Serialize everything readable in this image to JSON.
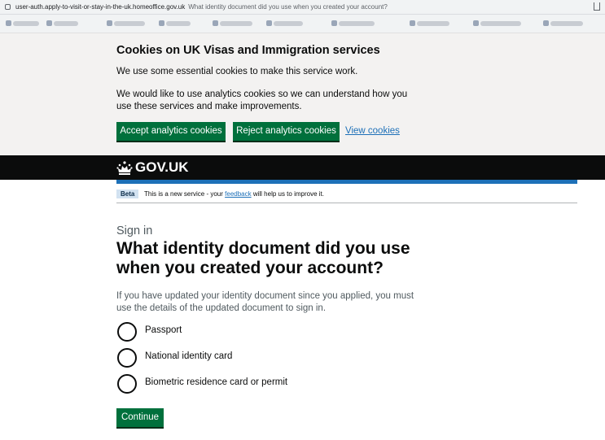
{
  "browser": {
    "url": "user-auth.apply-to-visit-or-stay-in-the-uk.homeoffice.gov.uk",
    "page_title": "What identity document did you use when you created your account?"
  },
  "cookie_banner": {
    "heading": "Cookies on UK Visas and Immigration services",
    "essential_text": "We use some essential cookies to make this service work.",
    "analytics_text": "We would like to use analytics cookies so we can understand how you use these services and make improvements.",
    "accept_label": "Accept analytics cookies",
    "reject_label": "Reject analytics cookies",
    "view_label": "View cookies"
  },
  "header": {
    "logo_text": "GOV.UK"
  },
  "phase_banner": {
    "tag": "Beta",
    "text_before": "This is a new service - your ",
    "link": "feedback",
    "text_after": " will help us to improve it."
  },
  "main": {
    "caption": "Sign in",
    "heading": "What identity document did you use when you created your account?",
    "hint": "If you have updated your identity document since you applied, you must use the details of the updated document to sign in.",
    "options": [
      "Passport",
      "National identity card",
      "Biometric residence card or permit"
    ],
    "continue_label": "Continue"
  },
  "colors": {
    "button_green": "#00703c",
    "link_blue": "#1d70b8",
    "header_black": "#0b0c0c",
    "banner_grey": "#f3f2f1"
  }
}
